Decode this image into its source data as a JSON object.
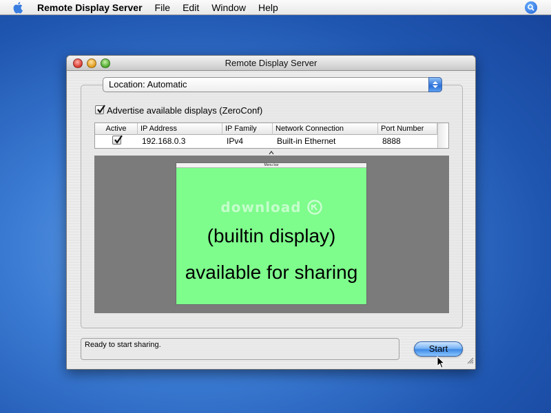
{
  "menubar": {
    "app_name": "Remote Display Server",
    "items": [
      "File",
      "Edit",
      "Window",
      "Help"
    ]
  },
  "window": {
    "title": "Remote Display Server",
    "location_popup": "Location: Automatic",
    "advertise_label": "Advertise available displays (ZeroConf)",
    "advertise_checked": true,
    "table": {
      "columns": [
        "Active",
        "IP Address",
        "IP Family",
        "Network Connection",
        "Port Number"
      ],
      "rows": [
        {
          "active": true,
          "ip_address": "192.168.0.3",
          "ip_family": "IPv4",
          "network_connection": "Built-in Ethernet",
          "port_number": "8888"
        }
      ]
    },
    "preview": {
      "menubar_label": "Menu bar",
      "watermark": "download",
      "line1": "(builtin display)",
      "line2": "available for sharing",
      "display_color": "#7efc8c"
    },
    "status_text": "Ready to start sharing.",
    "start_label": "Start"
  }
}
